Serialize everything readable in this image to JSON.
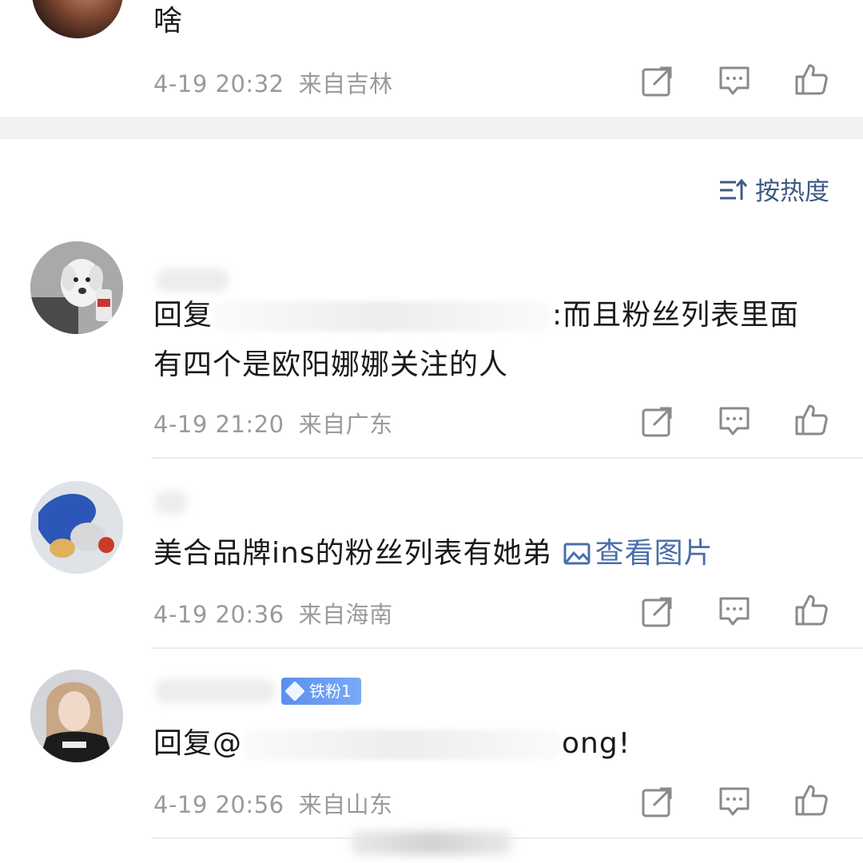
{
  "top_comment": {
    "content": "啥",
    "date": "4-19 20:32",
    "location": "来自吉林"
  },
  "sort": {
    "label": "按热度"
  },
  "comments": [
    {
      "content_prefix": "回复",
      "content_line1_tail": ":而且粉丝列表里面",
      "content_line2": "有四个是欧阳娜娜关注的人",
      "date": "4-19 21:20",
      "location": "来自广东"
    },
    {
      "content": "美合品牌ins的粉丝列表有她弟",
      "view_image": "查看图片",
      "date": "4-19 20:36",
      "location": "来自海南"
    },
    {
      "badge": "铁粉1",
      "content_prefix": "回复@",
      "content_tail": "ong!",
      "date": "4-19 20:56",
      "location": "来自山东"
    }
  ],
  "icons": {
    "share": "share-icon",
    "comment": "comment-icon",
    "like": "like-icon",
    "sort": "sort-icon",
    "image": "image-icon"
  },
  "colors": {
    "link": "#4a6ea9",
    "meta": "#9a9a9a",
    "badge": "#5b8ff0",
    "sort": "#3f5a86"
  }
}
